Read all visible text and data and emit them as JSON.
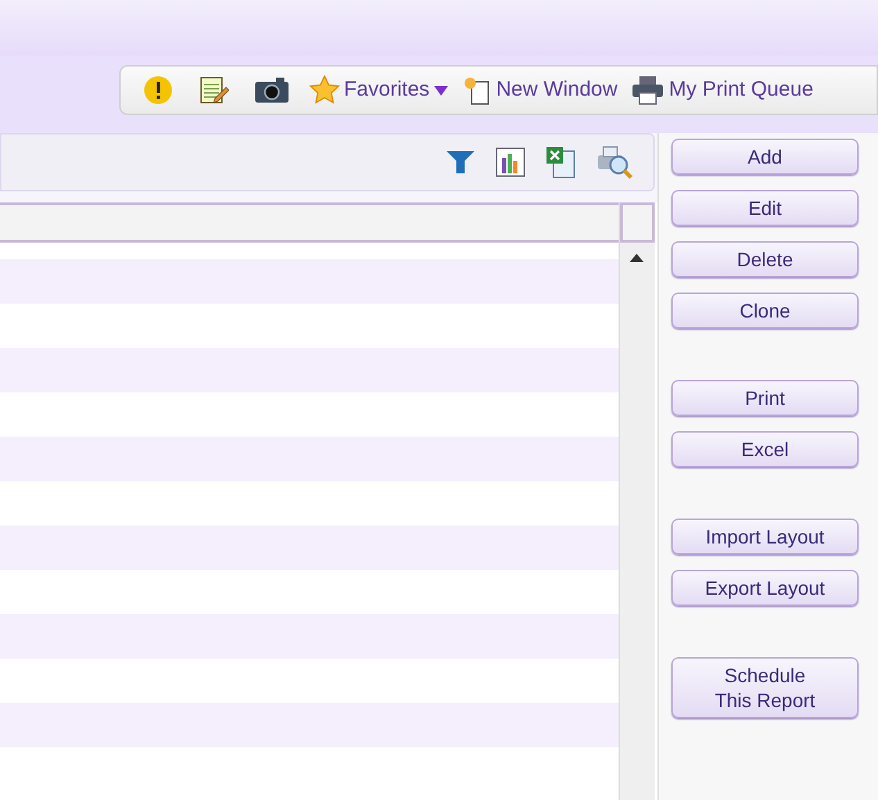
{
  "toolbar": [
    {
      "kind": "alert"
    },
    {
      "kind": "notepad"
    },
    {
      "kind": "camera"
    },
    {
      "kind": "favorites",
      "label": "Favorites"
    },
    {
      "kind": "new-window",
      "label": "New Window"
    },
    {
      "kind": "printer",
      "label": "My Print Queue"
    }
  ],
  "grid_toolbar": [
    {
      "kind": "filter"
    },
    {
      "kind": "chart"
    },
    {
      "kind": "excel"
    },
    {
      "kind": "preview"
    }
  ],
  "action_groups": [
    [
      {
        "label": "Add"
      },
      {
        "label": "Edit"
      },
      {
        "label": "Delete"
      },
      {
        "label": "Clone"
      }
    ],
    [
      {
        "label": "Print"
      },
      {
        "label": "Excel"
      }
    ],
    [
      {
        "label": "Import Layout"
      },
      {
        "label": "Export Layout"
      }
    ],
    [
      {
        "label": "Schedule\nThis Report"
      }
    ]
  ]
}
